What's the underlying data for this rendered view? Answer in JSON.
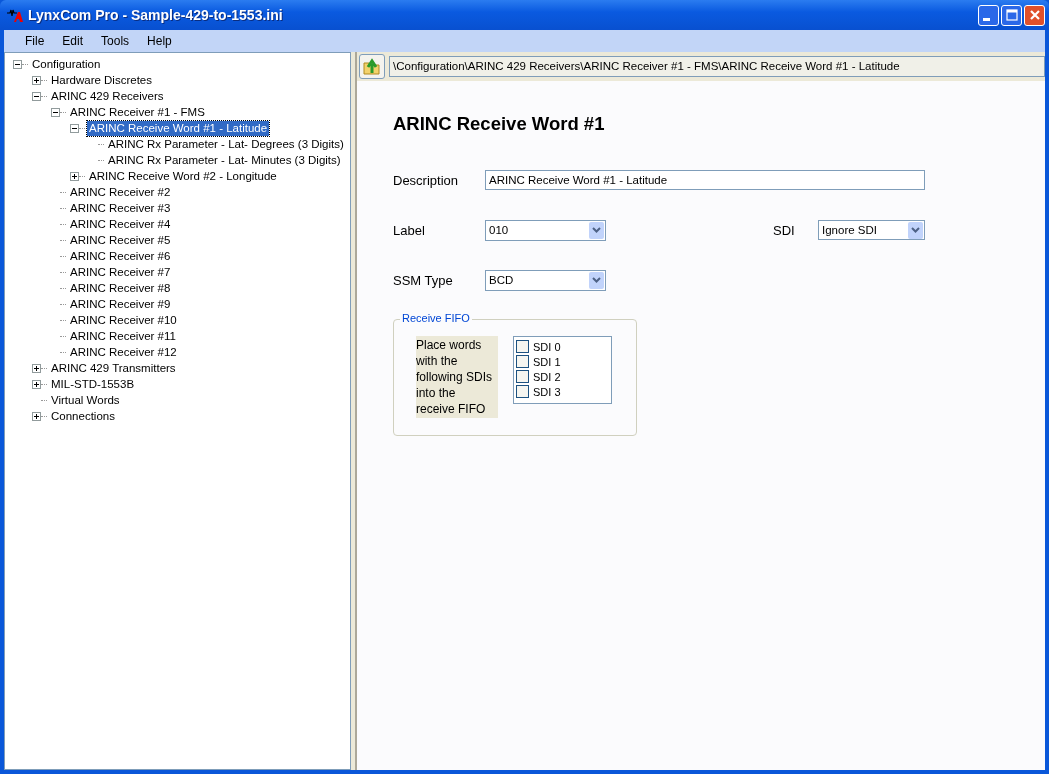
{
  "window": {
    "title": "LynxCom Pro - Sample-429-to-1553.ini"
  },
  "menu": [
    "File",
    "Edit",
    "Tools",
    "Help"
  ],
  "tree": [
    {
      "label": "Configuration",
      "expanded": true,
      "selected": false,
      "children": [
        {
          "label": "Hardware Discretes",
          "expanded": false,
          "selected": false
        },
        {
          "label": "ARINC 429 Receivers",
          "expanded": true,
          "selected": false,
          "children": [
            {
              "label": "ARINC Receiver #1 - FMS",
              "expanded": true,
              "selected": false,
              "children": [
                {
                  "label": "ARINC Receive Word #1 - Latitude",
                  "expanded": true,
                  "selected": true,
                  "children": [
                    {
                      "label": "ARINC Rx Parameter - Lat- Degrees (3 Digits)",
                      "selected": false
                    },
                    {
                      "label": "ARINC Rx Parameter - Lat- Minutes (3 Digits)",
                      "selected": false
                    }
                  ]
                },
                {
                  "label": "ARINC Receive Word #2 - Longitude",
                  "expanded": false,
                  "selected": false
                }
              ]
            },
            {
              "label": "ARINC Receiver #2",
              "selected": false
            },
            {
              "label": "ARINC Receiver #3",
              "selected": false
            },
            {
              "label": "ARINC Receiver #4",
              "selected": false
            },
            {
              "label": "ARINC Receiver #5",
              "selected": false
            },
            {
              "label": "ARINC Receiver #6",
              "selected": false
            },
            {
              "label": "ARINC Receiver #7",
              "selected": false
            },
            {
              "label": "ARINC Receiver #8",
              "selected": false
            },
            {
              "label": "ARINC Receiver #9",
              "selected": false
            },
            {
              "label": "ARINC Receiver #10",
              "selected": false
            },
            {
              "label": "ARINC Receiver #11",
              "selected": false
            },
            {
              "label": "ARINC Receiver #12",
              "selected": false
            }
          ]
        },
        {
          "label": "ARINC 429 Transmitters",
          "expanded": false,
          "selected": false
        },
        {
          "label": "MIL-STD-1553B",
          "expanded": false,
          "selected": false
        },
        {
          "label": "Virtual Words",
          "selected": false
        },
        {
          "label": "Connections",
          "expanded": false,
          "selected": false
        }
      ]
    }
  ],
  "path": "\\Configuration\\ARINC 429 Receivers\\ARINC Receiver #1 - FMS\\ARINC Receive Word #1 - Latitude",
  "heading": "ARINC Receive Word #1",
  "description": {
    "label": "Description",
    "value": "ARINC Receive Word #1 - Latitude"
  },
  "label_field": {
    "label": "Label",
    "value": "010"
  },
  "sdi_field": {
    "label": "SDI",
    "value": "Ignore SDI"
  },
  "ssm_field": {
    "label": "SSM Type",
    "value": "BCD"
  },
  "receive_fifo": {
    "title": "Receive FIFO",
    "note": "Place words with the following SDIs into the receive FIFO",
    "options": [
      {
        "label": "SDI 0",
        "checked": false
      },
      {
        "label": "SDI 1",
        "checked": false
      },
      {
        "label": "SDI 2",
        "checked": false
      },
      {
        "label": "SDI 3",
        "checked": false
      }
    ]
  }
}
